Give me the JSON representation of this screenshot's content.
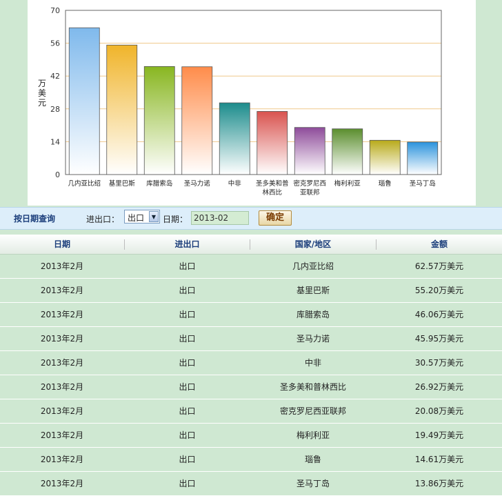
{
  "chart_data": {
    "type": "bar",
    "ylabel": "万美元",
    "ylim": [
      0,
      70
    ],
    "yticks": [
      0,
      14,
      28,
      42,
      56,
      70
    ],
    "categories": [
      "几内亚比绍",
      "基里巴斯",
      "库腊索岛",
      "圣马力诺",
      "中非",
      "圣多美和普林西比",
      "密克罗尼西亚联邦",
      "梅利利亚",
      "瑙鲁",
      "圣马丁岛"
    ],
    "values": [
      62.57,
      55.2,
      46.06,
      45.95,
      30.57,
      26.92,
      20.08,
      19.49,
      14.61,
      13.86
    ],
    "colors": [
      "#7fb9ec",
      "#f0b42a",
      "#88b620",
      "#ff8c4a",
      "#1c8c8c",
      "#d9534f",
      "#8e4c9a",
      "#5b8e2e",
      "#b8aa1a",
      "#2b93dc"
    ],
    "grid": true
  },
  "query": {
    "title": "按日期查询",
    "io_label": "进出口：",
    "io_value": "出口",
    "date_label": "日期：",
    "date_value": "2013-02",
    "confirm_label": "确定"
  },
  "table": {
    "headers": [
      "日期",
      "进出口",
      "国家/地区",
      "金额"
    ],
    "rows": [
      [
        "2013年2月",
        "出口",
        "几内亚比绍",
        "62.57万美元"
      ],
      [
        "2013年2月",
        "出口",
        "基里巴斯",
        "55.20万美元"
      ],
      [
        "2013年2月",
        "出口",
        "库腊索岛",
        "46.06万美元"
      ],
      [
        "2013年2月",
        "出口",
        "圣马力诺",
        "45.95万美元"
      ],
      [
        "2013年2月",
        "出口",
        "中非",
        "30.57万美元"
      ],
      [
        "2013年2月",
        "出口",
        "圣多美和普林西比",
        "26.92万美元"
      ],
      [
        "2013年2月",
        "出口",
        "密克罗尼西亚联邦",
        "20.08万美元"
      ],
      [
        "2013年2月",
        "出口",
        "梅利利亚",
        "19.49万美元"
      ],
      [
        "2013年2月",
        "出口",
        "瑙鲁",
        "14.61万美元"
      ],
      [
        "2013年2月",
        "出口",
        "圣马丁岛",
        "13.86万美元"
      ]
    ]
  }
}
